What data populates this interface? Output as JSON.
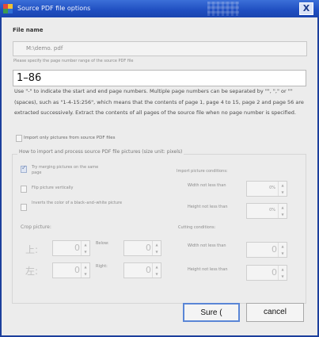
{
  "window": {
    "title": "Source PDF file options",
    "close_glyph": "X"
  },
  "file": {
    "label": "File name",
    "value": "M:\\demo. pdf"
  },
  "pages": {
    "label": "Please specify the page number range of the source PDF file",
    "value": "1–86",
    "help": "Use \"-\" to indicate the start and end page numbers. Multiple page numbers can be separated by \"\", \",\" or \"\" (spaces), such as \"1-4-15:256\", which means that the contents of page 1, page 4 to 15, page 2 and page 56 are extracted successively. Extract the contents of all pages of the source file when no page number is specified."
  },
  "import_only": {
    "label": "Import only pictures from source PDF files",
    "checked": false
  },
  "group": {
    "title": "How to import and process source PDF file pictures (size unit: pixels)",
    "try_merge": {
      "label": "Try merging pictures on the same page",
      "checked": true
    },
    "flip": {
      "label": "Flip picture vertically",
      "checked": false
    },
    "invert": {
      "label": "Inverts the color of a black–and–white picture",
      "checked": false
    },
    "import_conditions": "Import picture conditions:",
    "width_not_less": "Width not less than",
    "height_not_less": "Height not less than",
    "width_val": "0%",
    "height_val": "0%",
    "crop": {
      "label": "Crop picture:",
      "top_glyph": "上:",
      "left_glyph": "左:",
      "below_label": "Below:",
      "right_label": "Right:",
      "top_val": "0",
      "below_val": "0",
      "left_val": "0",
      "right_val": "0"
    },
    "cutting": {
      "label": "Cutting conditions:",
      "width_not_less": "Width not less than",
      "height_not_less": "Height not less than",
      "width_val": "0",
      "height_val": "0"
    }
  },
  "buttons": {
    "sure": "Sure  (",
    "cancel": "cancel"
  },
  "colors": {
    "titlebar": "#1f4ec0",
    "dialog_bg": "#ececec",
    "primary_button_border": "#5a86d6"
  },
  "icons": {
    "app": "app-icon",
    "close": "close-icon",
    "spin_up": "spin-up-icon",
    "spin_down": "spin-down-icon",
    "check": "check-icon"
  }
}
